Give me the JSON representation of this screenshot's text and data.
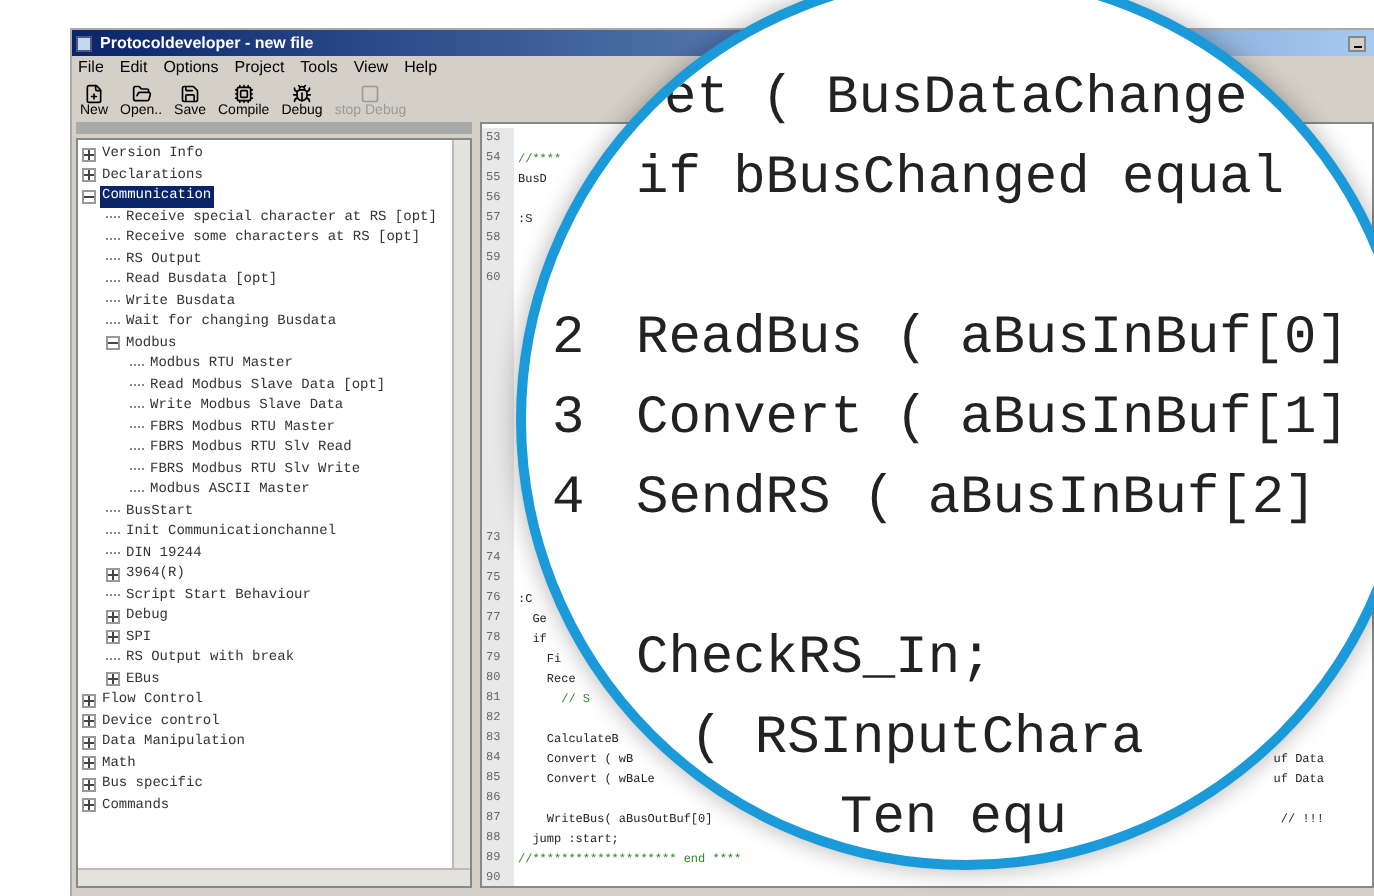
{
  "window": {
    "title": "Protocoldeveloper - new file"
  },
  "menu": [
    "File",
    "Edit",
    "Options",
    "Project",
    "Tools",
    "View",
    "Help"
  ],
  "toolbar": [
    {
      "kind": "new",
      "label": "New",
      "disabled": false
    },
    {
      "kind": "open",
      "label": "Open..",
      "disabled": false
    },
    {
      "kind": "save",
      "label": "Save",
      "disabled": false
    },
    {
      "kind": "compile",
      "label": "Compile",
      "disabled": false
    },
    {
      "kind": "debug",
      "label": "Debug",
      "disabled": false
    },
    {
      "kind": "stop",
      "label": "stop Debug",
      "disabled": true
    }
  ],
  "tree": [
    {
      "label": "Version Info",
      "expanded": false,
      "selected": false
    },
    {
      "label": "Declarations",
      "expanded": false,
      "selected": false
    },
    {
      "label": "Communication",
      "expanded": true,
      "selected": true,
      "children": [
        {
          "label": "Receive special character at RS [opt]",
          "selected": false
        },
        {
          "label": "Receive some characters at RS [opt]",
          "selected": false
        },
        {
          "label": "RS Output",
          "selected": false
        },
        {
          "label": "Read Busdata [opt]",
          "selected": false
        },
        {
          "label": "Write Busdata",
          "selected": false
        },
        {
          "label": "Wait for changing Busdata",
          "selected": false
        },
        {
          "label": "Modbus",
          "expanded": true,
          "selected": false,
          "children": [
            {
              "label": "Modbus RTU Master",
              "selected": false
            },
            {
              "label": "Read Modbus Slave Data [opt]",
              "selected": false
            },
            {
              "label": "Write Modbus Slave Data",
              "selected": false
            },
            {
              "label": "FBRS Modbus RTU Master",
              "selected": false
            },
            {
              "label": "FBRS Modbus RTU Slv Read",
              "selected": false
            },
            {
              "label": "FBRS Modbus RTU Slv Write",
              "selected": false
            },
            {
              "label": "Modbus ASCII Master",
              "selected": false
            }
          ]
        },
        {
          "label": "BusStart",
          "selected": false
        },
        {
          "label": "Init Communicationchannel",
          "selected": false
        },
        {
          "label": "DIN 19244",
          "selected": false
        },
        {
          "label": "3964(R)",
          "expanded": false,
          "selected": false
        },
        {
          "label": "Script Start Behaviour",
          "selected": false
        },
        {
          "label": "Debug",
          "expanded": false,
          "selected": false
        },
        {
          "label": "SPI",
          "expanded": false,
          "selected": false
        },
        {
          "label": "RS Output with break",
          "selected": false
        },
        {
          "label": "EBus",
          "expanded": false,
          "selected": false
        }
      ]
    },
    {
      "label": "Flow Control",
      "expanded": false,
      "selected": false
    },
    {
      "label": "Device control",
      "expanded": false,
      "selected": false
    },
    {
      "label": "Data Manipulation",
      "expanded": false,
      "selected": false
    },
    {
      "label": "Math",
      "expanded": false,
      "selected": false
    },
    {
      "label": "Bus specific",
      "expanded": false,
      "selected": false
    },
    {
      "label": "Commands",
      "expanded": false,
      "selected": false
    }
  ],
  "editor": {
    "lines_top": [
      {
        "number": "53",
        "kind": "blank"
      },
      {
        "number": "54",
        "text": "//****",
        "kind": "comment"
      },
      {
        "number": "55",
        "text": "BusD",
        "kind": "code"
      },
      {
        "number": "56",
        "kind": "blank"
      },
      {
        "number": "57",
        "text": ":S",
        "kind": "code"
      },
      {
        "number": "58",
        "kind": "blank"
      },
      {
        "number": "59",
        "kind": "blank"
      },
      {
        "number": "60",
        "kind": "blank"
      }
    ],
    "lines_bottom": [
      {
        "number": "73",
        "kind": "blank"
      },
      {
        "number": "74",
        "kind": "blank"
      },
      {
        "number": "75",
        "kind": "blank"
      },
      {
        "number": "76",
        "text": ":C",
        "kind": "code"
      },
      {
        "number": "77",
        "text": "  Ge",
        "kind": "code"
      },
      {
        "number": "78",
        "text": "  if",
        "kind": "code"
      },
      {
        "number": "79",
        "text": "    Fi",
        "kind": "code"
      },
      {
        "number": "80",
        "text": "    Rece",
        "kind": "code"
      },
      {
        "number": "81",
        "text": "      // S",
        "kind": "comment"
      },
      {
        "number": "82",
        "kind": "blank"
      },
      {
        "number": "83",
        "text": "    CalculateB",
        "kind": "code"
      },
      {
        "number": "84",
        "text": "    Convert ( wB",
        "kind": "code",
        "tail": "uf Data"
      },
      {
        "number": "85",
        "text": "    Convert ( wBaLe",
        "kind": "code",
        "tail": "uf Data"
      },
      {
        "number": "86",
        "kind": "blank"
      },
      {
        "number": "87",
        "text": "    WriteBus( aBusOutBuf[0]",
        "kind": "code",
        "tail": "// !!!"
      },
      {
        "number": "88",
        "text": "  jump :start;",
        "kind": "code"
      },
      {
        "number": "89",
        "text": "//******************** end ****",
        "kind": "comment"
      },
      {
        "number": "90",
        "kind": "blank"
      }
    ]
  },
  "magnifier": {
    "lines": [
      {
        "kind": "code",
        "text": "et ( BusDataChange"
      },
      {
        "kind": "code",
        "text": "if bBusChanged equal"
      },
      {
        "kind": "blank"
      },
      {
        "kind": "code",
        "number": "2",
        "text": "ReadBus ( aBusInBuf[0]"
      },
      {
        "kind": "code",
        "number": "3",
        "text": "Convert ( aBusInBuf[1]"
      },
      {
        "kind": "code",
        "number": "4",
        "text": "SendRS ( aBusInBuf[2]"
      },
      {
        "kind": "blank"
      },
      {
        "kind": "code",
        "text": "CheckRS_In;"
      },
      {
        "kind": "code",
        "text": "( RSInputChara"
      },
      {
        "kind": "code",
        "text": "Ten equ"
      }
    ]
  }
}
